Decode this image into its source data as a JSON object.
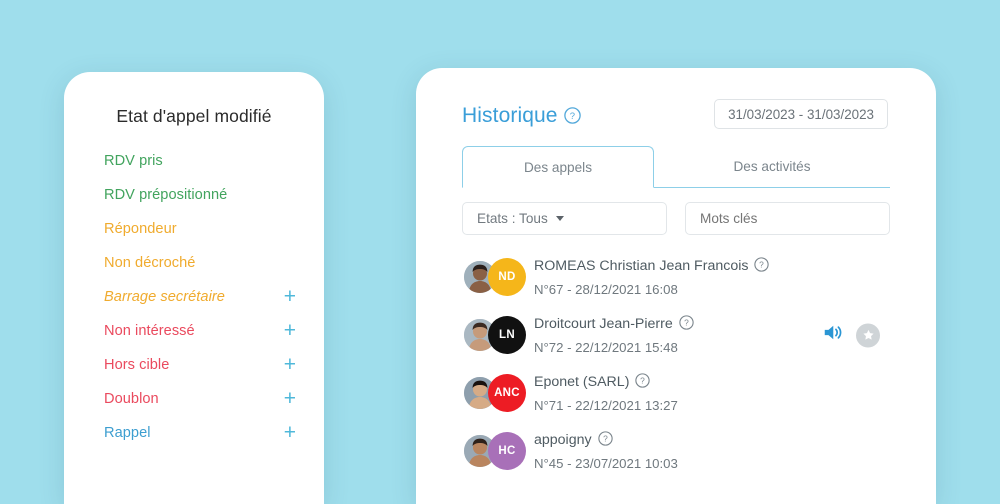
{
  "background_color": "#9fdeec",
  "left_panel": {
    "title": "Etat d'appel modifié",
    "states": [
      {
        "label": "RDV pris",
        "color": "#42a45e",
        "style": "normal",
        "has_plus": false,
        "plus_label": "+"
      },
      {
        "label": "RDV prépositionné",
        "color": "#42a45e",
        "style": "normal",
        "has_plus": false,
        "plus_label": "+"
      },
      {
        "label": "Répondeur",
        "color": "#f0ab2e",
        "style": "normal",
        "has_plus": false,
        "plus_label": "+"
      },
      {
        "label": "Non décroché",
        "color": "#f0ab2e",
        "style": "normal",
        "has_plus": false,
        "plus_label": "+"
      },
      {
        "label": "Barrage secrétaire",
        "color": "#f0ab2e",
        "style": "italic",
        "has_plus": true,
        "plus_label": "+"
      },
      {
        "label": "Non intéressé",
        "color": "#ea4a5e",
        "style": "normal",
        "has_plus": true,
        "plus_label": "+"
      },
      {
        "label": "Hors cible",
        "color": "#ea4a5e",
        "style": "normal",
        "has_plus": true,
        "plus_label": "+"
      },
      {
        "label": "Doublon",
        "color": "#ea4a5e",
        "style": "normal",
        "has_plus": true,
        "plus_label": "+"
      },
      {
        "label": "Rappel",
        "color": "#3d9ed0",
        "style": "normal",
        "has_plus": true,
        "plus_label": "+"
      }
    ]
  },
  "right_panel": {
    "title": "Historique",
    "title_help_icon": "help-circle-icon",
    "title_color": "#3a9ed8",
    "date_range": "31/03/2023 - 31/03/2023",
    "tabs": [
      {
        "label": "Des appels",
        "active": true
      },
      {
        "label": "Des activités",
        "active": false
      }
    ],
    "filters": {
      "states_label": "Etats : Tous",
      "states_caret_icon": "chevron-down-icon",
      "keywords_placeholder": "Mots clés"
    },
    "calls": [
      {
        "name": "ROMEAS Christian Jean Francois",
        "meta": "N°67 - 28/12/2021 16:08",
        "initials": "ND",
        "badge_color": "#f5b61a",
        "help_icon": "help-circle-icon",
        "has_audio": false,
        "has_star": false
      },
      {
        "name": "Droitcourt Jean-Pierre",
        "meta": "N°72 - 22/12/2021 15:48",
        "initials": "LN",
        "badge_color": "#111111",
        "help_icon": "help-circle-icon",
        "has_audio": true,
        "has_star": true
      },
      {
        "name": "Eponet (SARL)",
        "meta": "N°71 - 22/12/2021 13:27",
        "initials": "ANC",
        "badge_color": "#ed1c24",
        "help_icon": "help-circle-icon",
        "has_audio": false,
        "has_star": false
      },
      {
        "name": "appoigny",
        "meta": "N°45 - 23/07/2021 10:03",
        "initials": "HC",
        "badge_color": "#a870b8",
        "help_icon": "help-circle-icon",
        "has_audio": false,
        "has_star": false
      }
    ],
    "audio_icon": "speaker-sound-icon",
    "audio_icon_color": "#2b96d4",
    "star_icon": "star-icon",
    "star_icon_color": "#cfd4d7"
  }
}
